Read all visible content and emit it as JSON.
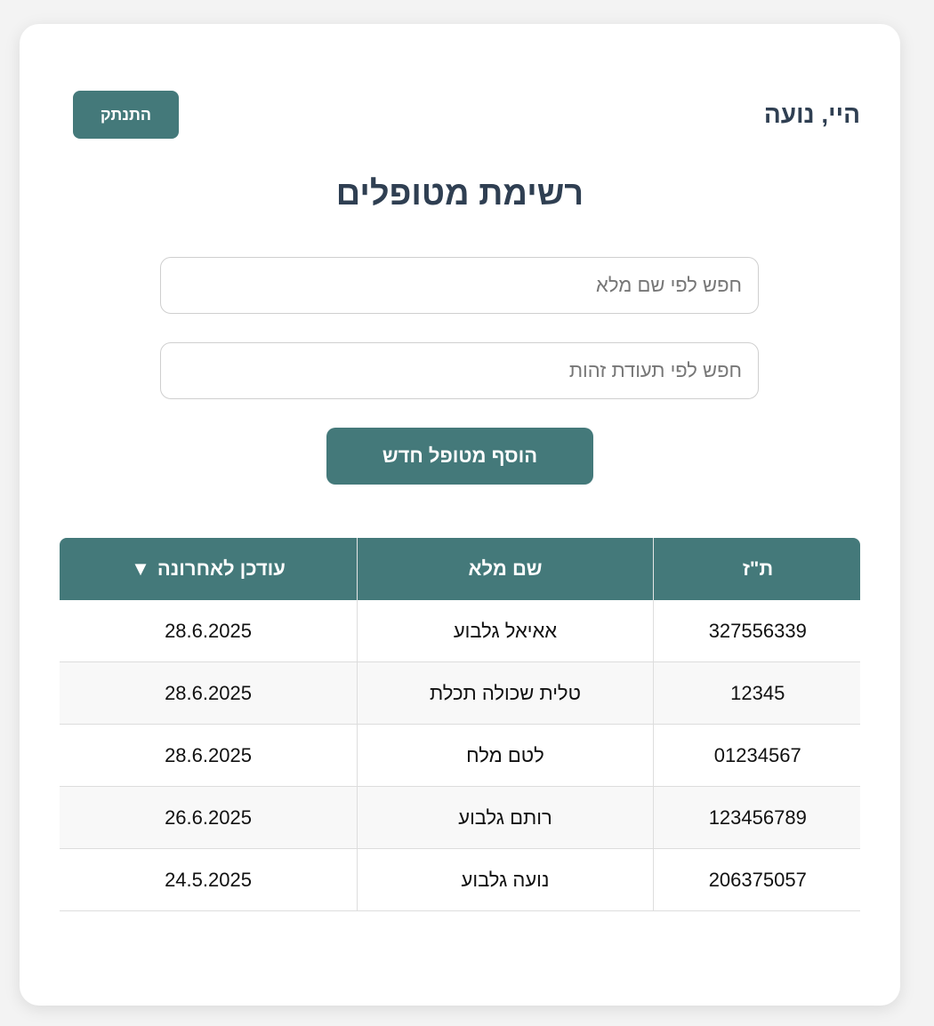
{
  "header": {
    "greeting": "היי, נועה",
    "logout_label": "התנתק"
  },
  "main": {
    "title": "רשימת מטופלים",
    "search_name_placeholder": "חפש לפי שם מלא",
    "search_id_placeholder": "חפש לפי תעודת זהות",
    "add_patient_label": "הוסף מטופל חדש"
  },
  "table": {
    "columns": {
      "id": "ת\"ז",
      "full_name": "שם מלא",
      "last_updated": "עודכן לאחרונה"
    },
    "sort_icon": "▼",
    "rows": [
      {
        "id": "327556339",
        "full_name": "אאיאל גלבוע",
        "last_updated": "28.6.2025"
      },
      {
        "id": "12345",
        "full_name": "טלית שכולה תכלת",
        "last_updated": "28.6.2025"
      },
      {
        "id": "01234567",
        "full_name": "לטם מלח",
        "last_updated": "28.6.2025"
      },
      {
        "id": "123456789",
        "full_name": "רותם גלבוע",
        "last_updated": "26.6.2025"
      },
      {
        "id": "206375057",
        "full_name": "נועה גלבוע",
        "last_updated": "24.5.2025"
      }
    ]
  },
  "colors": {
    "accent": "#44797a",
    "heading": "#2f3f52",
    "background": "#f3f3f3"
  }
}
